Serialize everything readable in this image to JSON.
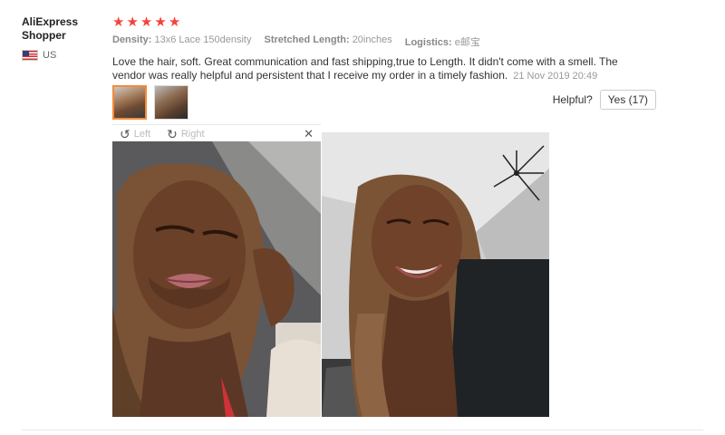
{
  "user": {
    "name": "AliExpress Shopper",
    "country": "US"
  },
  "review": {
    "rating": 5,
    "attributes": [
      {
        "name": "Density:",
        "value": "13x6 Lace 150density"
      },
      {
        "name": "Stretched Length:",
        "value": "20inches"
      },
      {
        "name": "Logistics:",
        "value": "e邮宝"
      }
    ],
    "text": "Love the hair, soft. Great communication and fast shipping,true to Length. It didn't come with a smell. The vendor was really helpful and persistent that I receive my order in a timely fashion.",
    "date": "21 Nov 2019 20:49"
  },
  "helpful": {
    "label": "Helpful?",
    "yes_label": "Yes (17)"
  },
  "viewer": {
    "left_label": "Left",
    "right_label": "Right",
    "close_icon": "close-icon"
  },
  "colors": {
    "star": "#f4443a",
    "active_thumb": "#f48b3a"
  }
}
